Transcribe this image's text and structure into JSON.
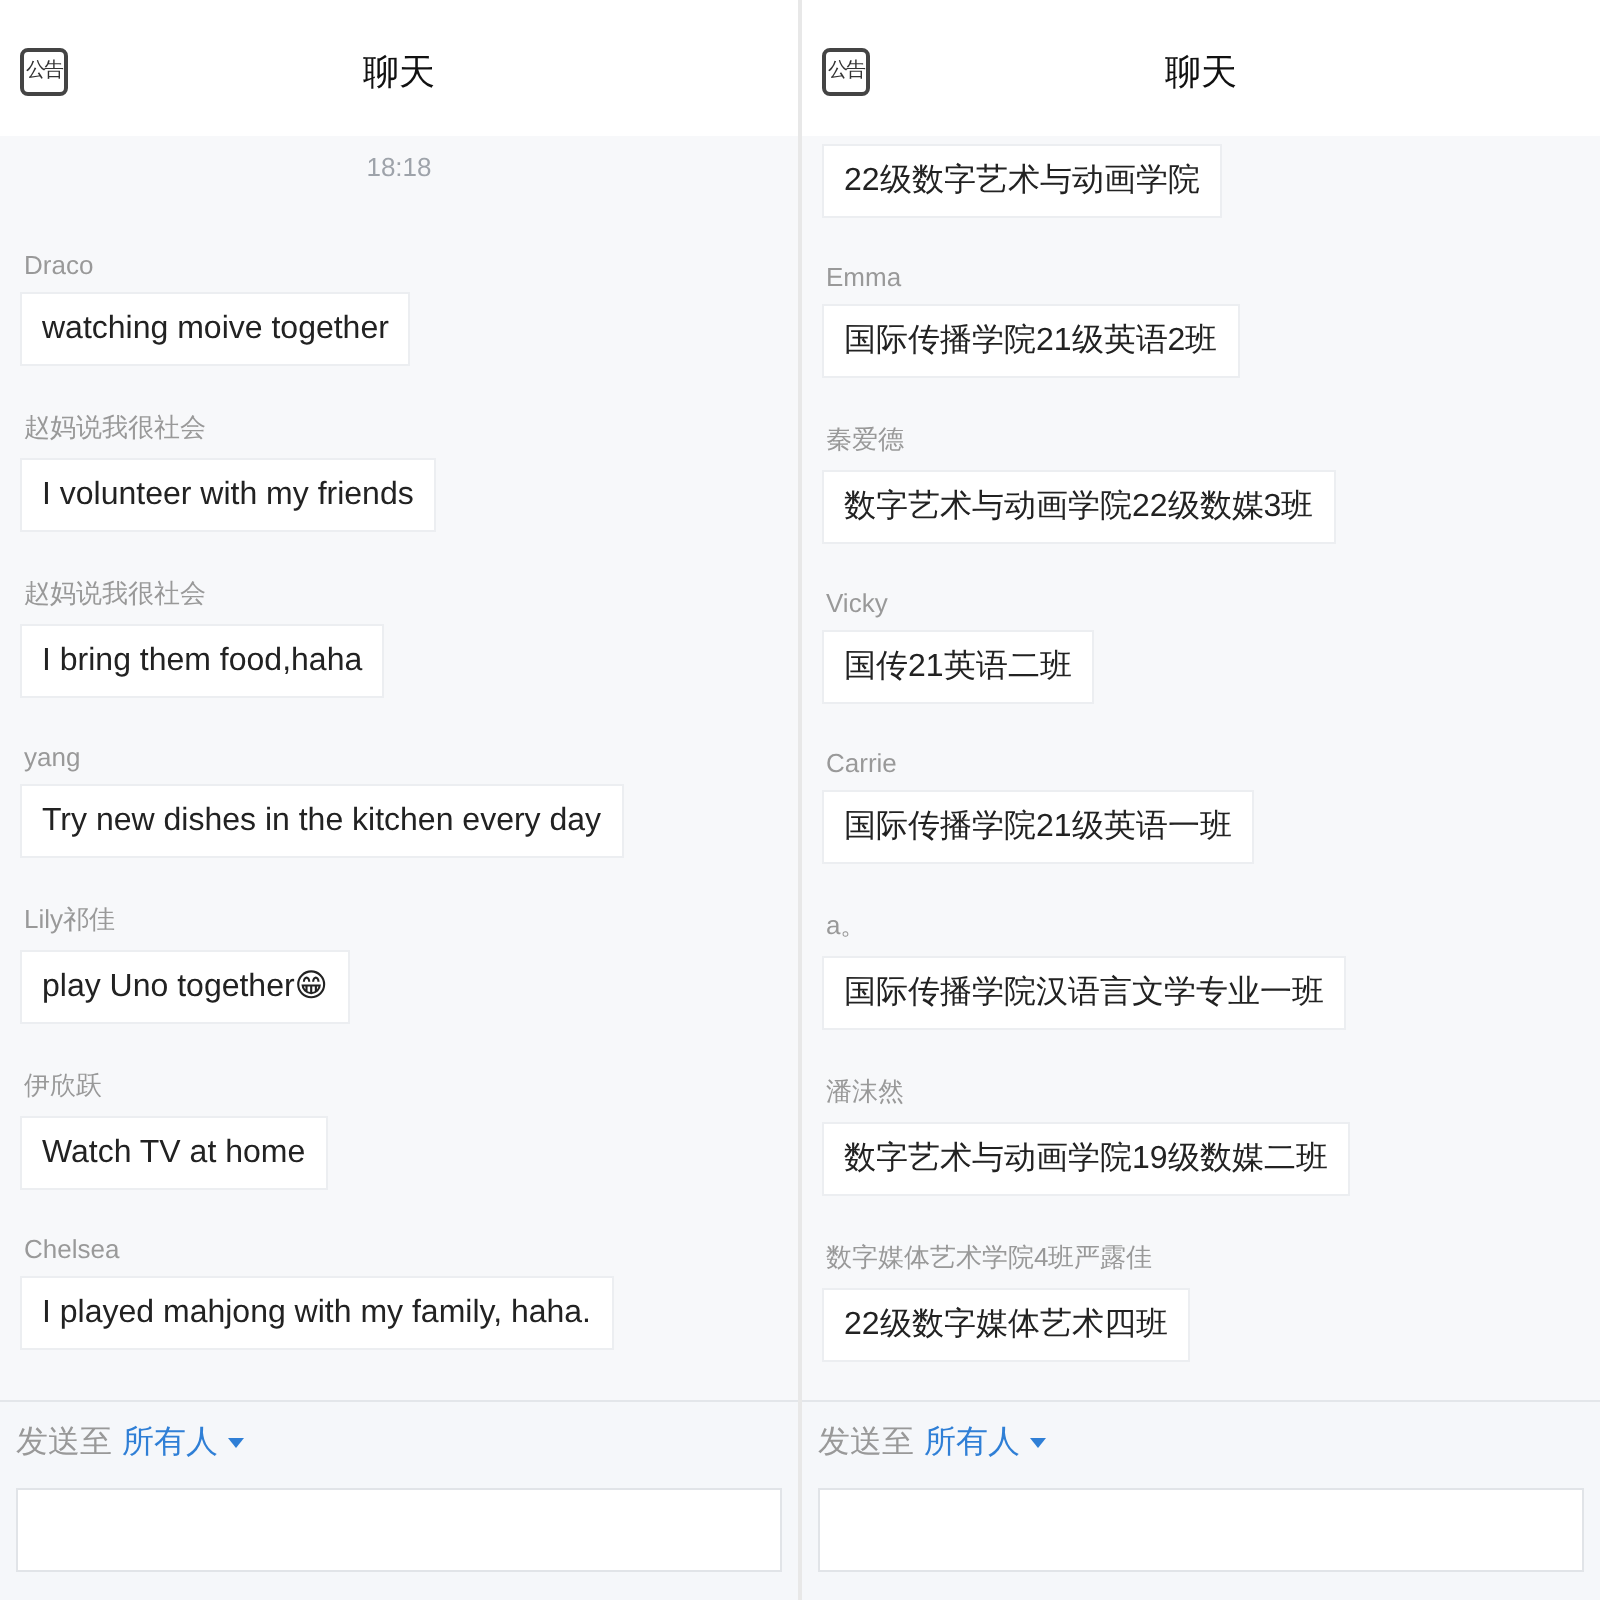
{
  "panes": [
    {
      "header": {
        "icon_label": "公告",
        "title": "聊天"
      },
      "timestamp": "18:18",
      "messages": [
        {
          "sender": "Draco",
          "text": "watching moive together"
        },
        {
          "sender": "赵妈说我很社会",
          "text": "I volunteer with my friends"
        },
        {
          "sender": "赵妈说我很社会",
          "text": "I bring them food,haha"
        },
        {
          "sender": "yang",
          "text": "Try new dishes in the kitchen every day"
        },
        {
          "sender": "Lily祁佳",
          "text": "play Uno together😁"
        },
        {
          "sender": "伊欣跃",
          "text": "Watch TV at home"
        },
        {
          "sender": "Chelsea",
          "text": "I played mahjong with my family, haha."
        }
      ],
      "footer": {
        "label": "发送至",
        "recipient": "所有人"
      }
    },
    {
      "header": {
        "icon_label": "公告",
        "title": "聊天"
      },
      "messages": [
        {
          "text": "22级数字艺术与动画学院"
        },
        {
          "sender": "Emma",
          "text": "国际传播学院21级英语2班"
        },
        {
          "sender": "秦爱德",
          "text": "数字艺术与动画学院22级数媒3班"
        },
        {
          "sender": "Vicky",
          "text": "国传21英语二班"
        },
        {
          "sender": "Carrie",
          "text": "国际传播学院21级英语一班"
        },
        {
          "sender": "a。",
          "text": "国际传播学院汉语言文学专业一班"
        },
        {
          "sender": "潘沫然",
          "text": "数字艺术与动画学院19级数媒二班"
        },
        {
          "sender": "数字媒体艺术学院4班严露佳",
          "text": "22级数字媒体艺术四班"
        }
      ],
      "footer": {
        "label": "发送至",
        "recipient": "所有人"
      }
    }
  ]
}
